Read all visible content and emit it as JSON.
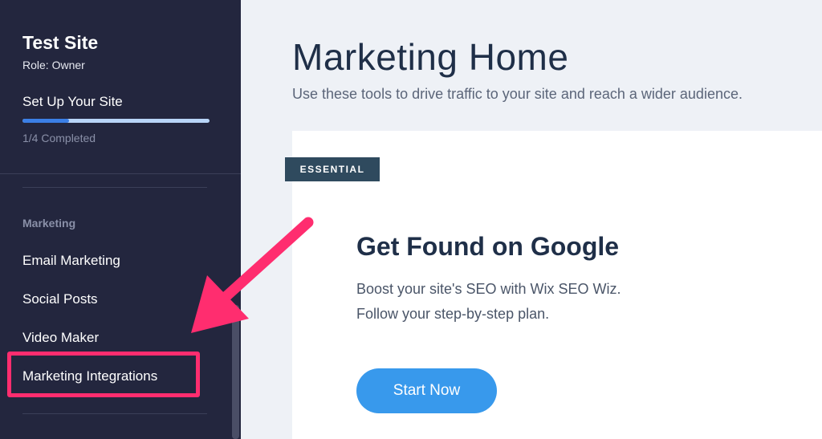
{
  "sidebar": {
    "site_name": "Test Site",
    "role": "Role: Owner",
    "setup": {
      "title": "Set Up Your Site",
      "progress": 0.25,
      "completed_text": "1/4 Completed"
    },
    "section_label": "Marketing",
    "items": [
      {
        "label": "Email Marketing"
      },
      {
        "label": "Social Posts"
      },
      {
        "label": "Video Maker"
      },
      {
        "label": "Marketing Integrations"
      }
    ]
  },
  "main": {
    "title": "Marketing Home",
    "subtitle": "Use these tools to drive traffic to your site and reach a wider audience.",
    "card": {
      "badge": "ESSENTIAL",
      "title": "Get Found on Google",
      "description_line1": "Boost your site's SEO with Wix SEO Wiz.",
      "description_line2": "Follow your step-by-step plan.",
      "button_label": "Start Now"
    }
  },
  "colors": {
    "sidebar_bg": "#23263e",
    "accent_blue": "#3899ec",
    "highlight_pink": "#ff2d6f",
    "badge_bg": "#2f4a5e"
  }
}
